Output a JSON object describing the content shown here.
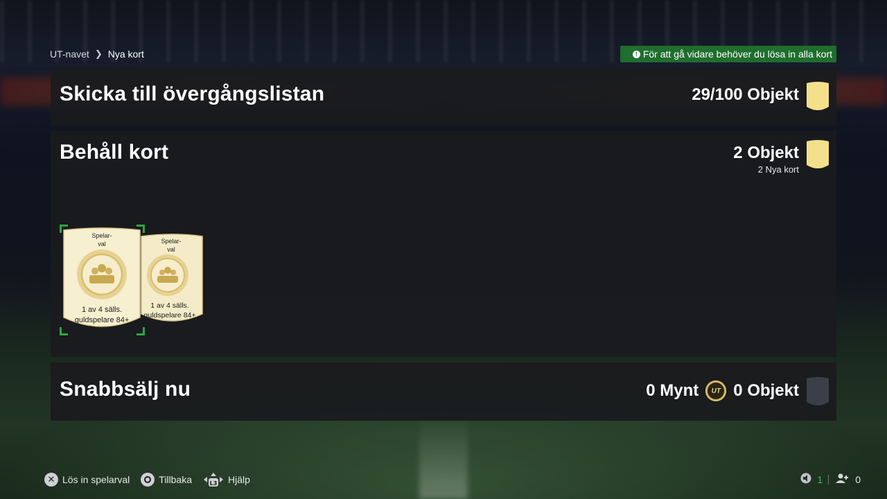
{
  "breadcrumb": {
    "root": "UT-navet",
    "current": "Nya kort"
  },
  "notice": {
    "text": "För att gå vidare behöver du lösa in alla kort",
    "color": "#1f6e2e"
  },
  "panels": {
    "transfer": {
      "title": "Skicka till övergångslistan",
      "count": "29/100 Objekt"
    },
    "keep": {
      "title": "Behåll kort",
      "count": "2 Objekt",
      "subcount": "2 Nya kort"
    },
    "quicksell": {
      "title": "Snabbsälj nu",
      "coins": "0 Mynt",
      "count": "0 Objekt"
    }
  },
  "cards": [
    {
      "title": "Spelar-\nval",
      "line1": "1 av 4 sälls.",
      "line2": "guldspelare 84+"
    },
    {
      "title": "Spelar-\nval",
      "line1": "1 av 4 sälls.",
      "line2": "guldspelare 84+"
    }
  ],
  "footer": {
    "redeem": "Lös in spelarval",
    "back": "Tillbaka",
    "help": "Hjälp",
    "help_button": "L3"
  },
  "status": {
    "notifications": "1",
    "friends": "0"
  },
  "colors": {
    "accent_green": "#29a83f",
    "gold_card": "#f2e7b5",
    "empty_slot": "#3a3f48"
  }
}
